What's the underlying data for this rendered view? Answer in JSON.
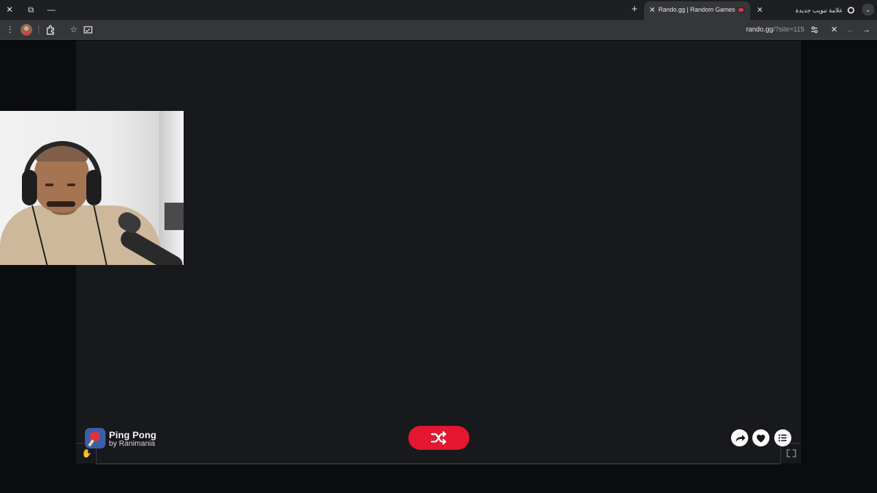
{
  "browser": {
    "active_tab": {
      "title": "Rando.gg | Random Games"
    },
    "inactive_tab": {
      "title": "علامة تبويب جديدة"
    },
    "url": {
      "host": "rando.gg",
      "path": "/?site=115"
    }
  },
  "game": {
    "name": "Ping Pong",
    "author": "by Ranimania"
  },
  "colors": {
    "accent": "#e5162f",
    "page_bg": "#0b0c0e",
    "game_bg": "#18191c"
  },
  "icons": {
    "window_close": "close-icon",
    "window_restore": "restore-icon",
    "window_minimize": "minimize-icon",
    "shuffle": "shuffle-icon",
    "share": "share-icon",
    "like": "heart-icon",
    "list": "list-icon"
  }
}
